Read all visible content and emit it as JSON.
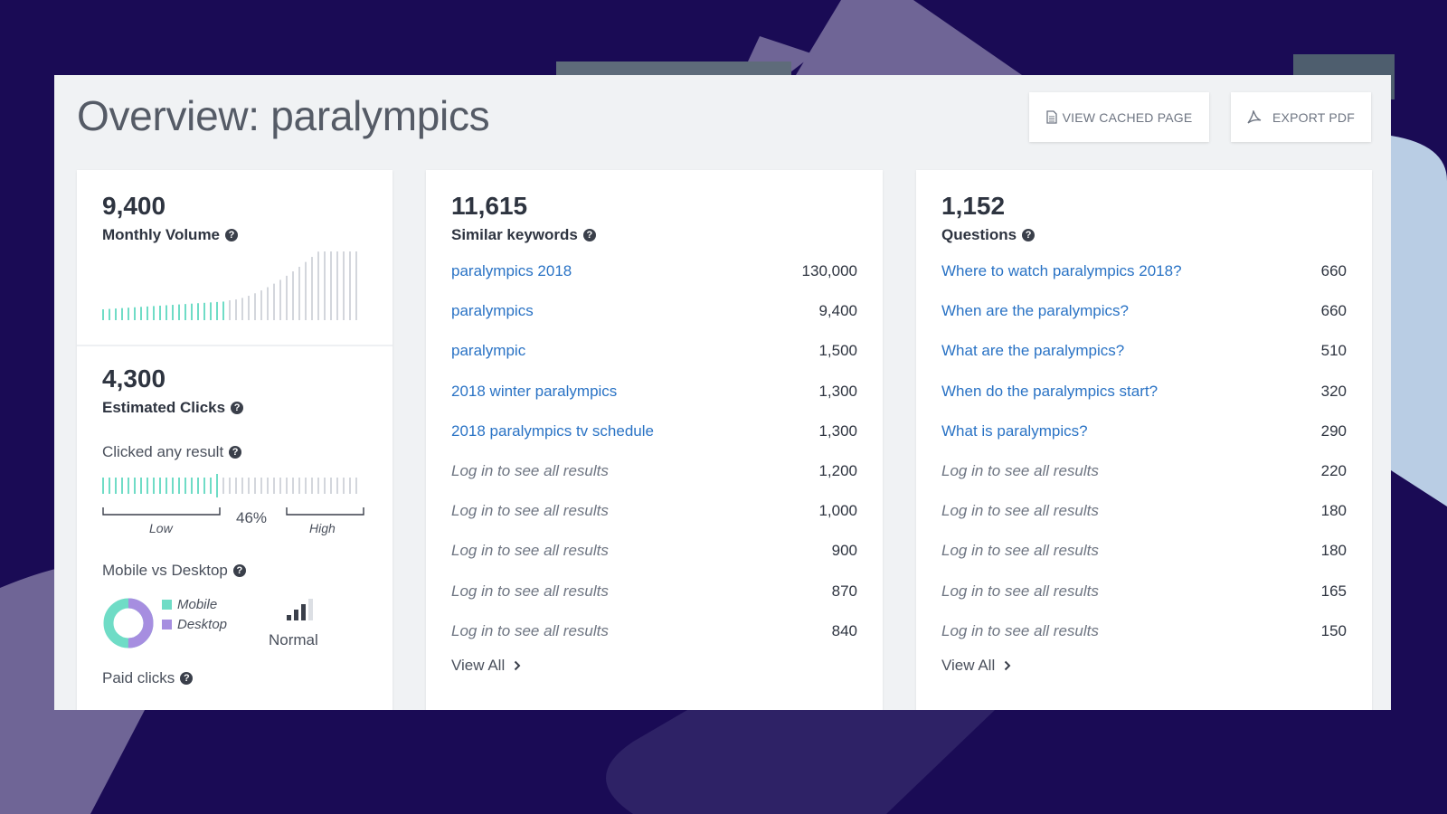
{
  "title": "Overview: paralympics",
  "toolbar": {
    "view_cached_label": "VIEW CACHED PAGE",
    "export_pdf_label": "EXPORT PDF"
  },
  "volume_card": {
    "monthly_volume": "9,400",
    "monthly_volume_label": "Monthly Volume",
    "estimated_clicks": "4,300",
    "estimated_clicks_label": "Estimated Clicks",
    "clicked_any_label": "Clicked any result",
    "clicked_any_percent": "46%",
    "clicked_any_fraction": 0.46,
    "range_low": "Low",
    "range_high": "High",
    "mobile_desktop_label": "Mobile vs Desktop",
    "legend": [
      {
        "label": "Mobile",
        "color": "#6fdcc6"
      },
      {
        "label": "Desktop",
        "color": "#a68ee0"
      }
    ],
    "mobile_share": 0.5,
    "device_level": "Normal",
    "paid_clicks_label": "Paid clicks"
  },
  "similar_keywords": {
    "count": "11,615",
    "label": "Similar keywords",
    "rows": [
      {
        "text": "paralympics 2018",
        "volume": "130,000",
        "locked": false
      },
      {
        "text": "paralympics",
        "volume": "9,400",
        "locked": false
      },
      {
        "text": "paralympic",
        "volume": "1,500",
        "locked": false
      },
      {
        "text": "2018 winter paralympics",
        "volume": "1,300",
        "locked": false
      },
      {
        "text": "2018 paralympics tv schedule",
        "volume": "1,300",
        "locked": false
      },
      {
        "text": "Log in to see all results",
        "volume": "1,200",
        "locked": true
      },
      {
        "text": "Log in to see all results",
        "volume": "1,000",
        "locked": true
      },
      {
        "text": "Log in to see all results",
        "volume": "900",
        "locked": true
      },
      {
        "text": "Log in to see all results",
        "volume": "870",
        "locked": true
      },
      {
        "text": "Log in to see all results",
        "volume": "840",
        "locked": true
      }
    ],
    "view_all": "View All"
  },
  "questions": {
    "count": "1,152",
    "label": "Questions",
    "rows": [
      {
        "text": "Where to watch paralympics 2018?",
        "volume": "660",
        "locked": false
      },
      {
        "text": "When are the paralympics?",
        "volume": "660",
        "locked": false
      },
      {
        "text": "What are the paralympics?",
        "volume": "510",
        "locked": false
      },
      {
        "text": "When do the paralympics start?",
        "volume": "320",
        "locked": false
      },
      {
        "text": "What is paralympics?",
        "volume": "290",
        "locked": false
      },
      {
        "text": "Log in to see all results",
        "volume": "220",
        "locked": true
      },
      {
        "text": "Log in to see all results",
        "volume": "180",
        "locked": true
      },
      {
        "text": "Log in to see all results",
        "volume": "180",
        "locked": true
      },
      {
        "text": "Log in to see all results",
        "volume": "165",
        "locked": true
      },
      {
        "text": "Log in to see all results",
        "volume": "150",
        "locked": true
      }
    ],
    "view_all": "View All"
  },
  "colors": {
    "accent_link": "#2a73c5",
    "teal": "#6fdcc6",
    "purple": "#a68ee0",
    "background": "#1a0b55"
  }
}
